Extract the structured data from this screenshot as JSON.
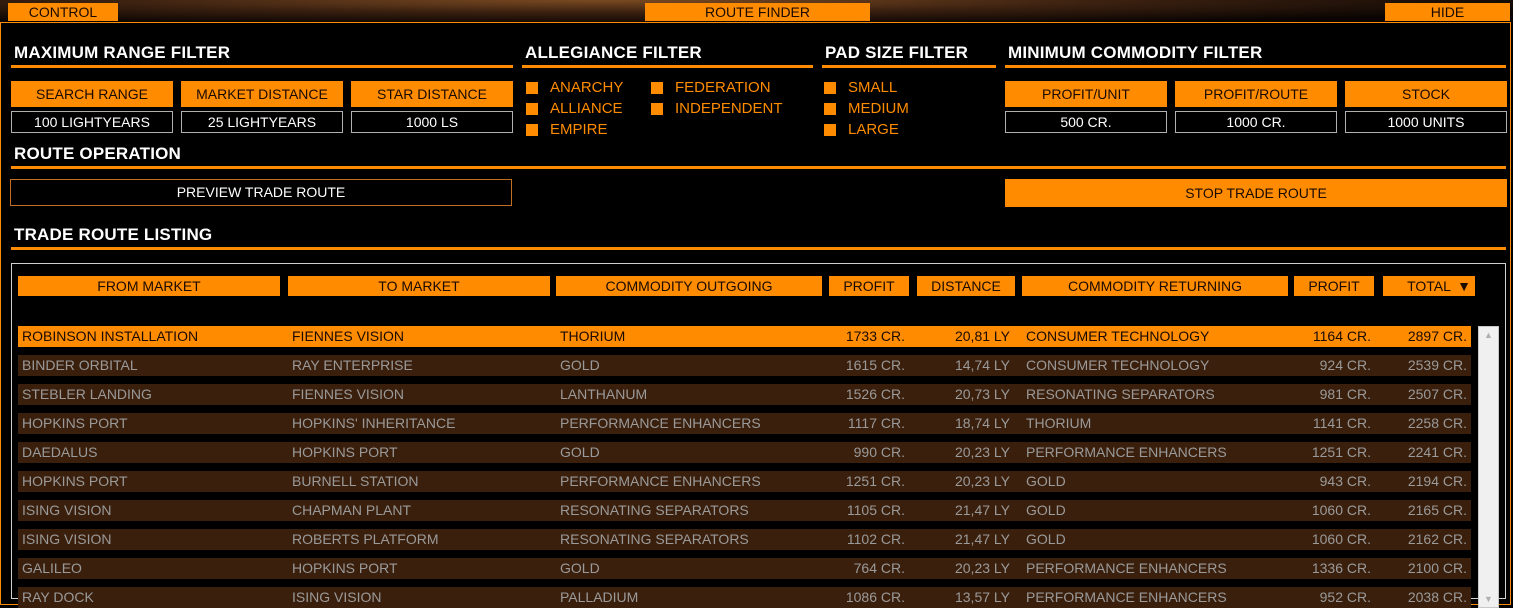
{
  "tabs": {
    "control": "CONTROL",
    "route_finder": "ROUTE FINDER",
    "hide": "HIDE"
  },
  "range_filter": {
    "title": "MAXIMUM RANGE FILTER",
    "buttons": [
      {
        "label": "SEARCH RANGE",
        "value": "100 LIGHTYEARS"
      },
      {
        "label": "MARKET DISTANCE",
        "value": "25 LIGHTYEARS"
      },
      {
        "label": "STAR DISTANCE",
        "value": "1000 LS"
      }
    ]
  },
  "allegiance_filter": {
    "title": "ALLEGIANCE FILTER",
    "options": [
      "ANARCHY",
      "ALLIANCE",
      "EMPIRE",
      "FEDERATION",
      "INDEPENDENT"
    ]
  },
  "pad_filter": {
    "title": "PAD SIZE FILTER",
    "options": [
      "SMALL",
      "MEDIUM",
      "LARGE"
    ]
  },
  "commodity_filter": {
    "title": "MINIMUM COMMODITY FILTER",
    "buttons": [
      {
        "label": "PROFIT/UNIT",
        "value": "500 CR."
      },
      {
        "label": "PROFIT/ROUTE",
        "value": "1000 CR."
      },
      {
        "label": "STOCK",
        "value": "1000 UNITS"
      }
    ]
  },
  "route_operation": {
    "title": "ROUTE OPERATION",
    "preview": "PREVIEW TRADE ROUTE",
    "stop": "STOP TRADE ROUTE"
  },
  "listing": {
    "title": "TRADE ROUTE LISTING",
    "columns": [
      "FROM MARKET",
      "TO MARKET",
      "COMMODITY OUTGOING",
      "PROFIT",
      "DISTANCE",
      "COMMODITY RETURNING",
      "PROFIT",
      "TOTAL"
    ],
    "sort_indicator": "▼",
    "rows": [
      [
        "ROBINSON INSTALLATION",
        "FIENNES VISION",
        "THORIUM",
        "1733 CR.",
        "20,81 LY",
        "CONSUMER TECHNOLOGY",
        "1164 CR.",
        "2897 CR."
      ],
      [
        "BINDER ORBITAL",
        "RAY ENTERPRISE",
        "GOLD",
        "1615 CR.",
        "14,74 LY",
        "CONSUMER TECHNOLOGY",
        "924 CR.",
        "2539 CR."
      ],
      [
        "STEBLER LANDING",
        "FIENNES VISION",
        "LANTHANUM",
        "1526 CR.",
        "20,73 LY",
        "RESONATING SEPARATORS",
        "981 CR.",
        "2507 CR."
      ],
      [
        "HOPKINS PORT",
        "HOPKINS' INHERITANCE",
        "PERFORMANCE ENHANCERS",
        "1117 CR.",
        "18,74 LY",
        "THORIUM",
        "1141 CR.",
        "2258 CR."
      ],
      [
        "DAEDALUS",
        "HOPKINS PORT",
        "GOLD",
        "990 CR.",
        "20,23 LY",
        "PERFORMANCE ENHANCERS",
        "1251 CR.",
        "2241 CR."
      ],
      [
        "HOPKINS PORT",
        "BURNELL STATION",
        "PERFORMANCE ENHANCERS",
        "1251 CR.",
        "20,23 LY",
        "GOLD",
        "943 CR.",
        "2194 CR."
      ],
      [
        "ISING VISION",
        "CHAPMAN PLANT",
        "RESONATING SEPARATORS",
        "1105 CR.",
        "21,47 LY",
        "GOLD",
        "1060 CR.",
        "2165 CR."
      ],
      [
        "ISING VISION",
        "ROBERTS PLATFORM",
        "RESONATING SEPARATORS",
        "1102 CR.",
        "21,47 LY",
        "GOLD",
        "1060 CR.",
        "2162 CR."
      ],
      [
        "GALILEO",
        "HOPKINS PORT",
        "GOLD",
        "764 CR.",
        "20,23 LY",
        "PERFORMANCE ENHANCERS",
        "1336 CR.",
        "2100 CR."
      ],
      [
        "RAY DOCK",
        "ISING VISION",
        "PALLADIUM",
        "1086 CR.",
        "13,57 LY",
        "PERFORMANCE ENHANCERS",
        "952 CR.",
        "2038 CR."
      ]
    ]
  },
  "colors": {
    "accent": "#ff8c00",
    "row_bg": "#3a1f0c",
    "row_text": "#9a9a9a"
  }
}
